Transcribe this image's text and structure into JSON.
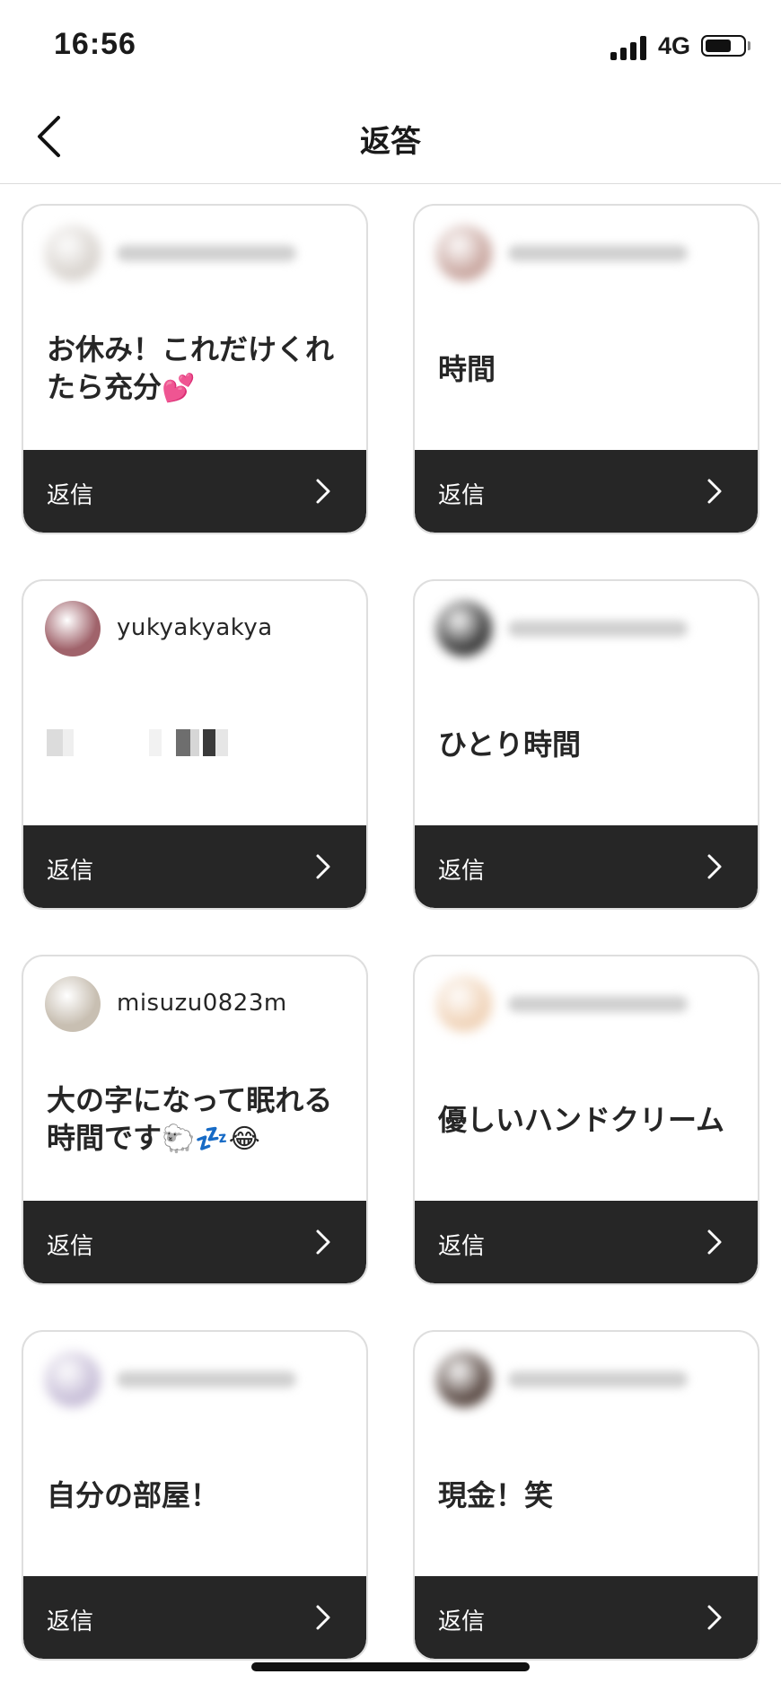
{
  "status_bar": {
    "time": "16:56",
    "network": "4G",
    "battery_level": 0.7
  },
  "nav": {
    "title": "返答"
  },
  "cards": [
    {
      "username": "",
      "answer": "お休み！これだけくれたら充分",
      "emoji": "💕",
      "reply_label": "返信",
      "avatar_color": "#d9d4cf",
      "blurred": true
    },
    {
      "username": "",
      "answer": "時間",
      "emoji": "",
      "reply_label": "返信",
      "avatar_color": "#c9a7a0",
      "blurred": true
    },
    {
      "username": "yukyakyakya",
      "answer": "",
      "emoji": "",
      "reply_label": "返信",
      "avatar_color": "#a0636b",
      "blurred": false
    },
    {
      "username": "",
      "answer": "ひとり時間",
      "emoji": "",
      "reply_label": "返信",
      "avatar_color": "#3a3a3a",
      "blurred": true
    },
    {
      "username": "misuzu0823m",
      "answer": "大の字になって眠れる時間です",
      "emoji": "🐑💤😂",
      "reply_label": "返信",
      "avatar_color": "#c8bfb2",
      "blurred": false
    },
    {
      "username": "",
      "answer": "優しいハンドクリーム",
      "emoji": "",
      "reply_label": "返信",
      "avatar_color": "#f0d3b8",
      "blurred": true
    },
    {
      "username": "",
      "answer": "自分の部屋！",
      "emoji": "",
      "reply_label": "返信",
      "avatar_color": "#c8bfd8",
      "blurred": true
    },
    {
      "username": "",
      "answer": "現金！笑",
      "emoji": "",
      "reply_label": "返信",
      "avatar_color": "#5a4a44",
      "blurred": true
    }
  ]
}
